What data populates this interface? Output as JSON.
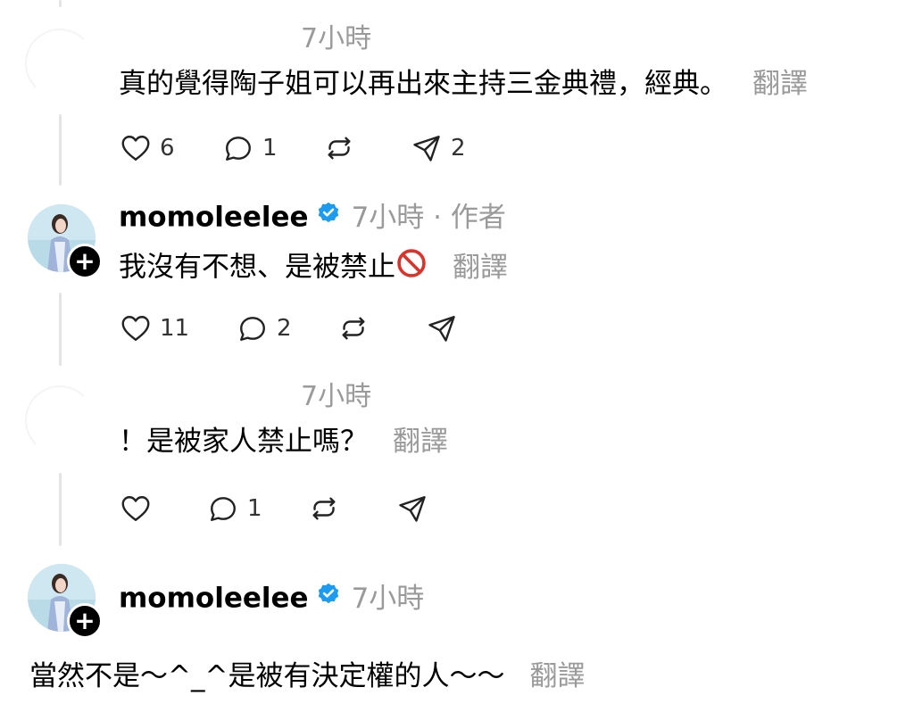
{
  "comment1": {
    "time": "7小時",
    "text": "真的覺得陶子姐可以再出來主持三金典禮，經典。",
    "translate": "翻譯",
    "likes": "6",
    "replies": "1",
    "shares": "2"
  },
  "reply1": {
    "username": "momoleelee",
    "meta": "7小時 · 作者",
    "text": "我沒有不想、是被禁止",
    "translate": "翻譯",
    "likes": "11",
    "replies": "2"
  },
  "comment2": {
    "time": "7小時",
    "text": "！是被家人禁止嗎？",
    "translate": "翻譯",
    "replies": "1"
  },
  "reply2": {
    "username": "momoleelee",
    "meta": "7小時",
    "text": "當然不是～^_^是被有決定權的人～～",
    "translate": "翻譯"
  },
  "colors": {
    "verified": "#1d9bf0",
    "muted": "#9a9a9a",
    "thread_line": "#e4e4e4"
  },
  "icons": [
    "heart-icon",
    "comment-icon",
    "repost-icon",
    "share-icon",
    "verified-badge-icon",
    "follow-plus-icon",
    "no-entry-emoji"
  ]
}
